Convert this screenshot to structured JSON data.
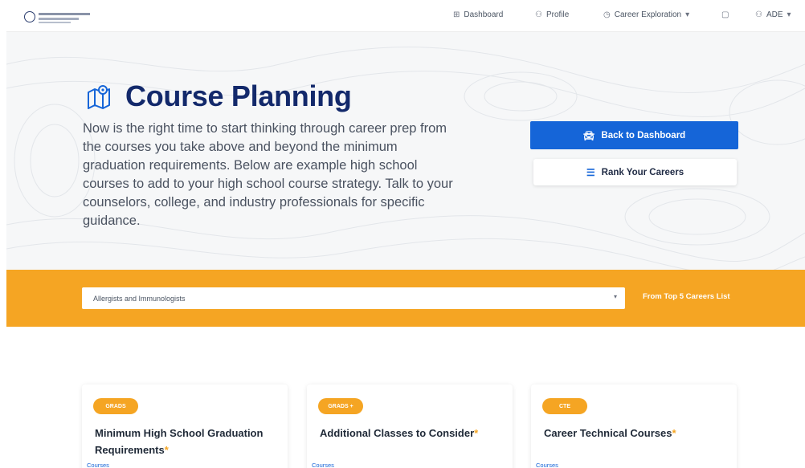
{
  "nav": {
    "links": [
      {
        "label": "Dashboard",
        "icon": "grid-icon"
      },
      {
        "label": "Profile",
        "icon": "person-icon"
      },
      {
        "label": "Career Exploration",
        "icon": "compass-icon"
      },
      {
        "label": "",
        "icon": "bookmark-icon"
      },
      {
        "label": "ADE",
        "icon": "user-icon"
      }
    ]
  },
  "hero": {
    "title": "Course Planning",
    "intro": "Now is the right time to start thinking through career prep from the courses you take above and beyond the minimum graduation requirements. Below are example high school courses to add to your high school course strategy. Talk to your counselors, college, and industry professionals for specific guidance.",
    "primary_button": "Back to Dashboard",
    "secondary_button": "Rank Your Careers"
  },
  "filter": {
    "selected_career": "Allergists and Immunologists",
    "list_link": "From Top 5 Careers List"
  },
  "cards": [
    {
      "badge": "GRADS",
      "title": "Minimum High School Graduation Requirements",
      "required_mark": "*",
      "link": "Courses"
    },
    {
      "badge": "GRADS +",
      "title": "Additional Classes to Consider",
      "required_mark": "*",
      "link": "Courses"
    },
    {
      "badge": "CTE",
      "title": "Career Technical Courses",
      "required_mark": "*",
      "link": "Courses"
    }
  ],
  "colors": {
    "brand_navy": "#13296b",
    "primary_blue": "#1565d8",
    "accent_orange": "#f5a523"
  }
}
